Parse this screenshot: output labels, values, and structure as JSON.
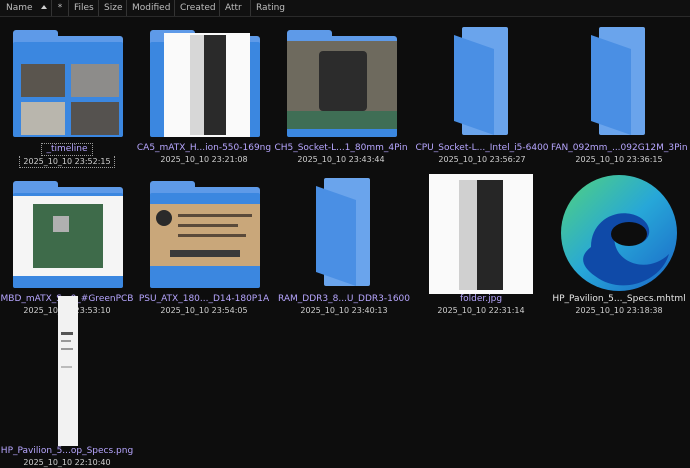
{
  "header": {
    "columns": [
      "Name",
      "*",
      "Files",
      "Size",
      "Modified",
      "Created",
      "Attr",
      "Rating"
    ]
  },
  "items": [
    {
      "name": "_timeline",
      "date": "2025_10_10 23:52:15",
      "kind": "folder-thumb"
    },
    {
      "name": "CA5_mATX_H...ion-550-169ng",
      "date": "2025_10_10 23:21:08",
      "kind": "folder-thumb"
    },
    {
      "name": "CH5_Socket-L...1_80mm_4Pin",
      "date": "2025_10_10 23:43:44",
      "kind": "folder-thumb"
    },
    {
      "name": "CPU_Socket-L..._Intel_i5-6400",
      "date": "2025_10_10 23:56:27",
      "kind": "folder-empty"
    },
    {
      "name": "FAN_092mm_...092G12M_3Pin",
      "date": "2025_10_10 23:36:15",
      "kind": "folder-empty"
    },
    {
      "name": "MBD_mATX_S...0_#GreenPCB",
      "date": "2025_10_10 23:53:10",
      "kind": "folder-thumb"
    },
    {
      "name": "PSU_ATX_180..._D14-180P1A",
      "date": "2025_10_10 23:54:05",
      "kind": "folder-thumb"
    },
    {
      "name": "RAM_DDR3_8...U_DDR3-1600",
      "date": "2025_10_10 23:40:13",
      "kind": "folder-empty"
    },
    {
      "name": "folder.jpg",
      "date": "2025_10_10 22:31:14",
      "kind": "image"
    },
    {
      "name": "HP_Pavilion_5..._Specs.mhtml",
      "date": "2025_10_10 23:18:38",
      "kind": "edge"
    },
    {
      "name": "HP_Pavilion_5...op_Specs.png",
      "date": "2025_10_10 22:10:40",
      "kind": "png"
    }
  ],
  "colors": {
    "background": "#0d0d0d",
    "folder": "#3b87e0",
    "label": "#b7a6ff"
  }
}
